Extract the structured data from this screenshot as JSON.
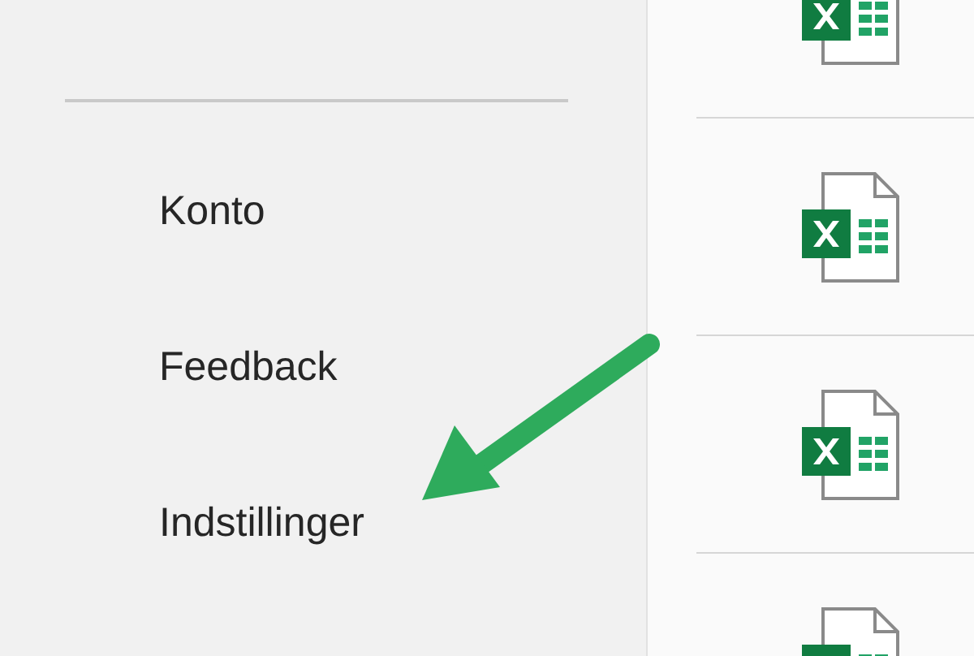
{
  "menu": {
    "items": [
      {
        "label": "Konto"
      },
      {
        "label": "Feedback"
      },
      {
        "label": "Indstillinger"
      }
    ]
  },
  "files": [
    {
      "kind": "excel"
    },
    {
      "kind": "excel"
    },
    {
      "kind": "excel"
    },
    {
      "kind": "excel"
    }
  ]
}
